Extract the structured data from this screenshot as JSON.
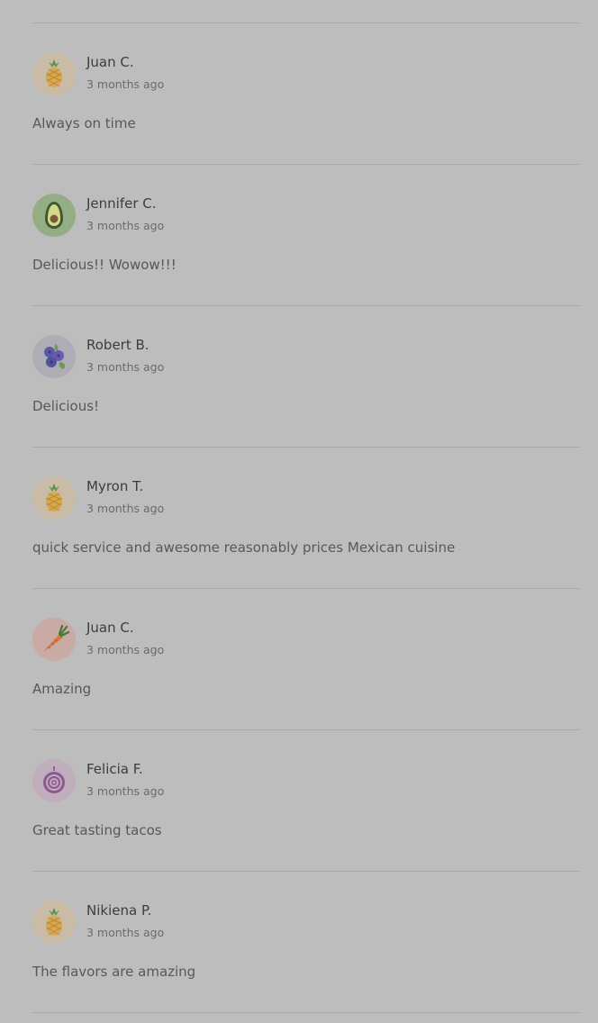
{
  "reviews": [
    {
      "name": "Juan C.",
      "time": "3 months ago",
      "text": "Always on time",
      "avatar_icon": "pineapple-icon",
      "avatar_bg": "#c9bba5"
    },
    {
      "name": "Jennifer C.",
      "time": "3 months ago",
      "text": "Delicious!! Wowow!!!",
      "avatar_icon": "avocado-icon",
      "avatar_bg": "#95ad84"
    },
    {
      "name": "Robert B.",
      "time": "3 months ago",
      "text": "Delicious!",
      "avatar_icon": "blueberry-icon",
      "avatar_bg": "#aeadb6"
    },
    {
      "name": "Myron T.",
      "time": "3 months ago",
      "text": "quick service and awesome reasonably prices Mexican cuisine",
      "avatar_icon": "pineapple-icon",
      "avatar_bg": "#c9bba5"
    },
    {
      "name": "Juan C.",
      "time": "3 months ago",
      "text": "Amazing",
      "avatar_icon": "carrot-icon",
      "avatar_bg": "#c9aaa5"
    },
    {
      "name": "Felicia F.",
      "time": "3 months ago",
      "text": "Great tasting tacos",
      "avatar_icon": "onion-icon",
      "avatar_bg": "#c1aebd"
    },
    {
      "name": "Nikiena P.",
      "time": "3 months ago",
      "text": "The flavors are amazing",
      "avatar_icon": "pineapple-icon",
      "avatar_bg": "#c9bba5"
    }
  ]
}
